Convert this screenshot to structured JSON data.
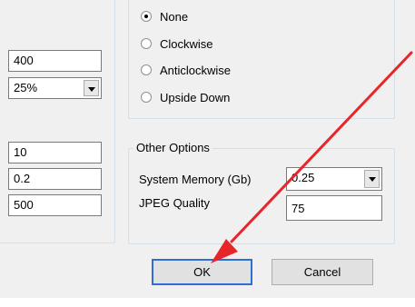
{
  "left_panel": {
    "size_value": "400",
    "scale_value": "25%",
    "field_a": "10",
    "field_b": "0.2",
    "field_c": "500"
  },
  "rotation": {
    "options": [
      "None",
      "Clockwise",
      "Anticlockwise",
      "Upside Down"
    ],
    "selected": "None"
  },
  "other_options": {
    "title": "Other Options",
    "memory_label": "System Memory (Gb)",
    "memory_value": "0.25",
    "jpeg_label": "JPEG Quality",
    "jpeg_value": "75"
  },
  "buttons": {
    "ok": "OK",
    "cancel": "Cancel"
  },
  "annotation": {
    "arrow_color": "#e8262a"
  }
}
